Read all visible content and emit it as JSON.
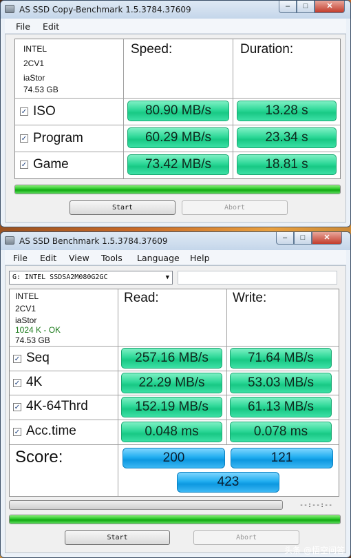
{
  "copy_window": {
    "title": "AS SSD Copy-Benchmark 1.5.3784.37609",
    "window_controls": {
      "minimize": "–",
      "maximize": "□",
      "close": "✕"
    },
    "menu": [
      "File",
      "Edit"
    ],
    "drive_info": [
      "INTEL",
      "2CV1",
      "iaStor",
      "74.53 GB"
    ],
    "headers": {
      "speed": "Speed:",
      "duration": "Duration:"
    },
    "rows": [
      {
        "label": "ISO",
        "speed": "80.90 MB/s",
        "duration": "13.28 s"
      },
      {
        "label": "Program",
        "speed": "60.29 MB/s",
        "duration": "23.34 s"
      },
      {
        "label": "Game",
        "speed": "73.42 MB/s",
        "duration": "18.81 s"
      }
    ],
    "progress": 1.0,
    "buttons": {
      "start": "Start",
      "abort": "Abort"
    }
  },
  "bench_window": {
    "title": "AS SSD Benchmark 1.5.3784.37609",
    "window_controls": {
      "minimize": "–",
      "maximize": "□",
      "close": "✕"
    },
    "menu": [
      "File",
      "Edit",
      "View",
      "Tools",
      "Language",
      "Help"
    ],
    "drive_select": "G: INTEL SSDSA2M080G2GC",
    "drive_info": [
      "INTEL",
      "2CV1",
      "iaStor",
      "1024 K - OK",
      "74.53 GB"
    ],
    "headers": {
      "read": "Read:",
      "write": "Write:"
    },
    "rows": [
      {
        "label": "Seq",
        "read": "257.16 MB/s",
        "write": "71.64 MB/s"
      },
      {
        "label": "4K",
        "read": "22.29 MB/s",
        "write": "53.03 MB/s"
      },
      {
        "label": "4K-64Thrd",
        "read": "152.19 MB/s",
        "write": "61.13 MB/s"
      },
      {
        "label": "Acc.time",
        "read": "0.048 ms",
        "write": "0.078 ms"
      }
    ],
    "score": {
      "label": "Score:",
      "read": "200",
      "write": "121",
      "total": "423"
    },
    "time_readout": "--:--:--",
    "progress_top": 0.0,
    "progress_bottom": 1.0,
    "buttons": {
      "start": "Start",
      "abort": "Abort"
    }
  },
  "watermark": "头条 @悟空问答",
  "colors": {
    "value_box": "#2ed898",
    "score_box": "#22aef0",
    "progress_fill": "#1fbf1f",
    "ok_text": "#1a7a1a"
  }
}
